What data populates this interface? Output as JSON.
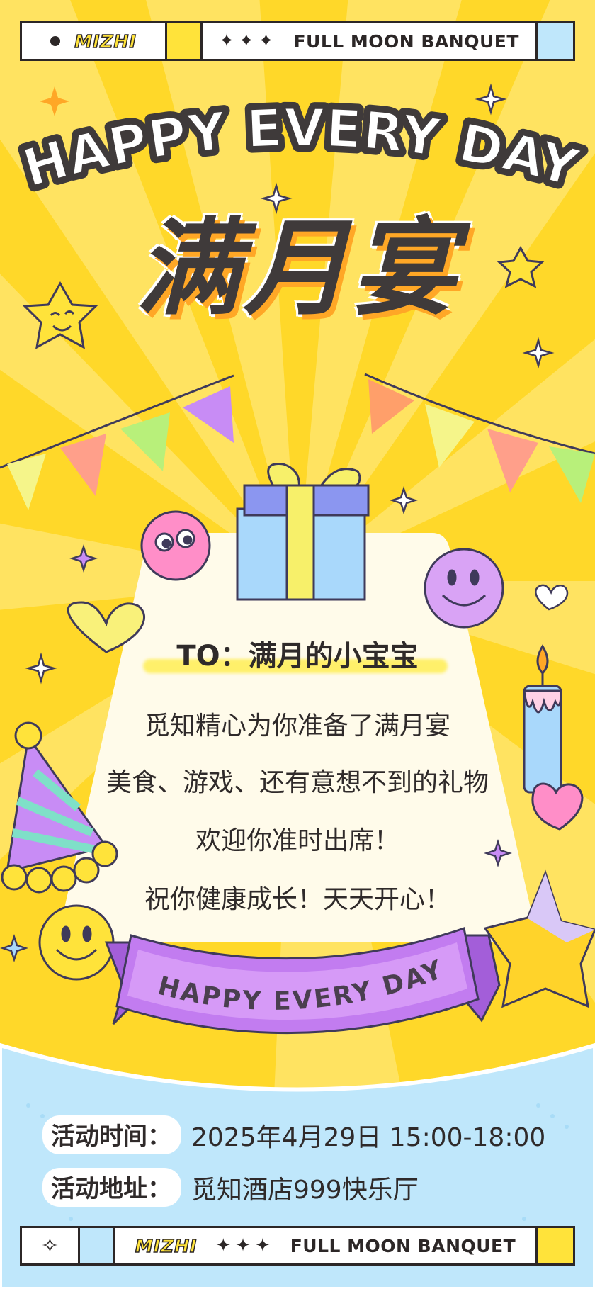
{
  "header": {
    "brand": "MIZHI",
    "stars": "✦✦✦",
    "title": "FULL MOON BANQUET"
  },
  "headline": {
    "english": "HAPPY EVERY DAY",
    "chinese": "满月宴"
  },
  "card": {
    "to": "TO：满月的小宝宝",
    "lines": [
      "觅知精心为你准备了满月宴",
      "美食、游戏、还有意想不到的礼物",
      "欢迎你准时出席！",
      "祝你健康成长！天天开心！"
    ]
  },
  "ribbon": {
    "text": "HAPPY EVERY DAY"
  },
  "event": {
    "time_label": "活动时间：",
    "time_value": "2025年4月29日 15:00-18:00",
    "address_label": "活动地址：",
    "address_value": "觅知酒店999快乐厅"
  },
  "footer": {
    "brand": "MIZHI",
    "stars": "✦✦✦",
    "title": "FULL MOON BANQUET"
  },
  "colors": {
    "background": "#ffd829",
    "ray": "#ffe56b",
    "card": "#fffbea",
    "ribbon": "#c27cf0",
    "bottom_panel": "#bfe7fb",
    "text": "#2f2a2a"
  }
}
